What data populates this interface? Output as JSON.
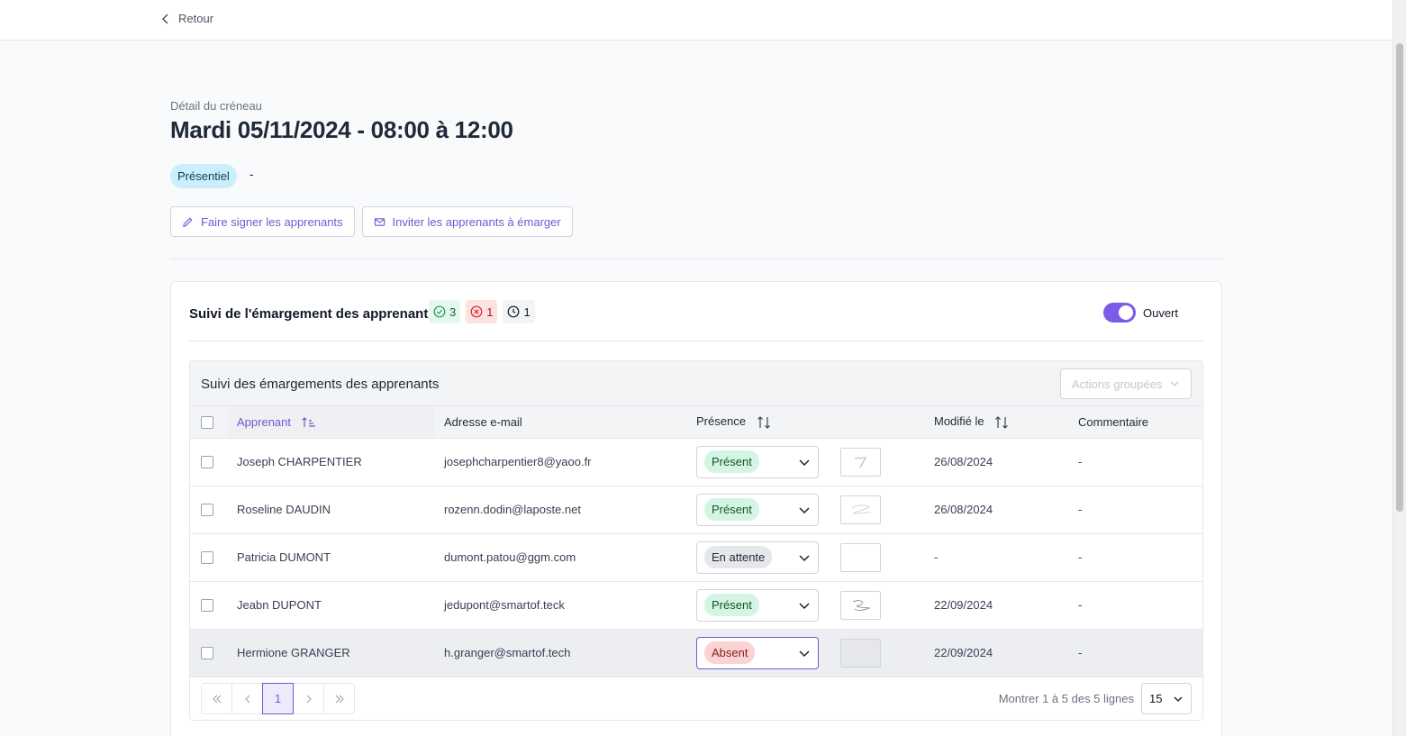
{
  "nav": {
    "back_label": "Retour"
  },
  "header": {
    "subtitle": "Détail du créneau",
    "title": "Mardi 05/11/2024 - 08:00 à 12:00",
    "mode_badge": "Présentiel",
    "mode_extra": "-"
  },
  "actions": {
    "sign_label": "Faire signer les apprenants",
    "invite_label": "Inviter les apprenants à émarger"
  },
  "card": {
    "title": "Suivi de l'émargement des apprenants",
    "counters": {
      "present": "3",
      "absent": "1",
      "pending": "1"
    },
    "toggle_label": "Ouvert"
  },
  "table": {
    "title": "Suivi des émargements des apprenants",
    "grouped_actions": "Actions groupées",
    "columns": {
      "learner": "Apprenant",
      "email": "Adresse e-mail",
      "presence": "Présence",
      "modified": "Modifié le",
      "comment": "Commentaire"
    },
    "rows": [
      {
        "name": "Joseph CHARPENTIER",
        "email": "josephcharpentier8@yaoo.fr",
        "presence": "Présent",
        "modified": "26/08/2024",
        "comment": "-"
      },
      {
        "name": "Roseline DAUDIN",
        "email": "rozenn.dodin@laposte.net",
        "presence": "Présent",
        "modified": "26/08/2024",
        "comment": "-"
      },
      {
        "name": "Patricia DUMONT",
        "email": "dumont.patou@ggm.com",
        "presence": "En attente",
        "modified": "-",
        "comment": "-"
      },
      {
        "name": "Jeabn DUPONT",
        "email": "jedupont@smartof.teck",
        "presence": "Présent",
        "modified": "22/09/2024",
        "comment": "-"
      },
      {
        "name": "Hermione GRANGER",
        "email": "h.granger@smartof.tech",
        "presence": "Absent",
        "modified": "22/09/2024",
        "comment": "-"
      }
    ]
  },
  "pagination": {
    "current_page": "1",
    "summary": "Montrer 1 à 5 des 5 lignes",
    "page_size": "15"
  },
  "colors": {
    "accent": "#6d5bd0",
    "toggle": "#7c5ce6",
    "present_bg": "#d4f5e3",
    "absent_bg": "#fbd3d3",
    "pending_bg": "#e5e7eb"
  }
}
